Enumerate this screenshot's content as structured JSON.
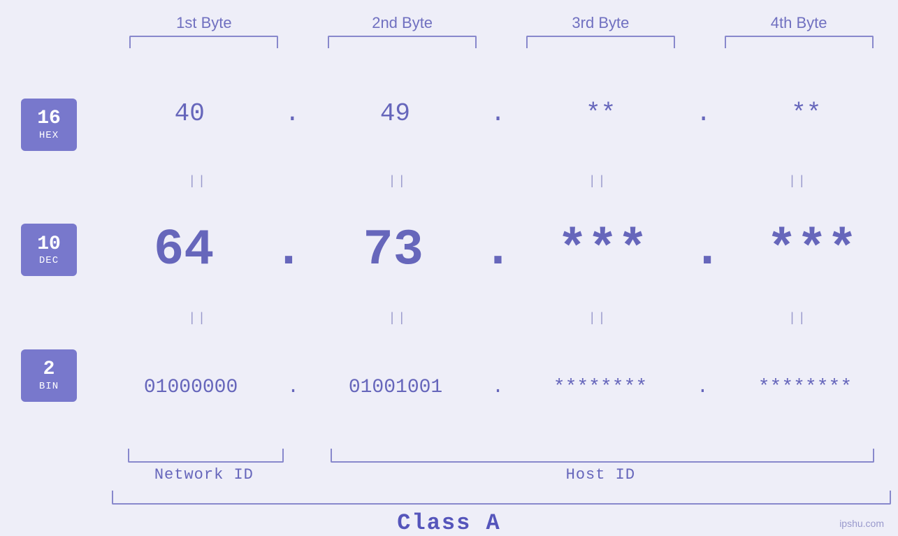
{
  "header": {
    "bytes": [
      "1st Byte",
      "2nd Byte",
      "3rd Byte",
      "4th Byte"
    ]
  },
  "bases": [
    {
      "number": "16",
      "label": "HEX"
    },
    {
      "number": "10",
      "label": "DEC"
    },
    {
      "number": "2",
      "label": "BIN"
    }
  ],
  "hex_row": {
    "values": [
      "40",
      "49",
      "**",
      "**"
    ],
    "dot": "."
  },
  "dec_row": {
    "values": [
      "64",
      "73",
      "***",
      "***"
    ],
    "dot": "."
  },
  "bin_row": {
    "values": [
      "01000000",
      "01001001",
      "********",
      "********"
    ],
    "dot": "."
  },
  "pipe_symbol": "||",
  "labels": {
    "network_id": "Network ID",
    "host_id": "Host ID",
    "class": "Class A"
  },
  "watermark": "ipshu.com"
}
